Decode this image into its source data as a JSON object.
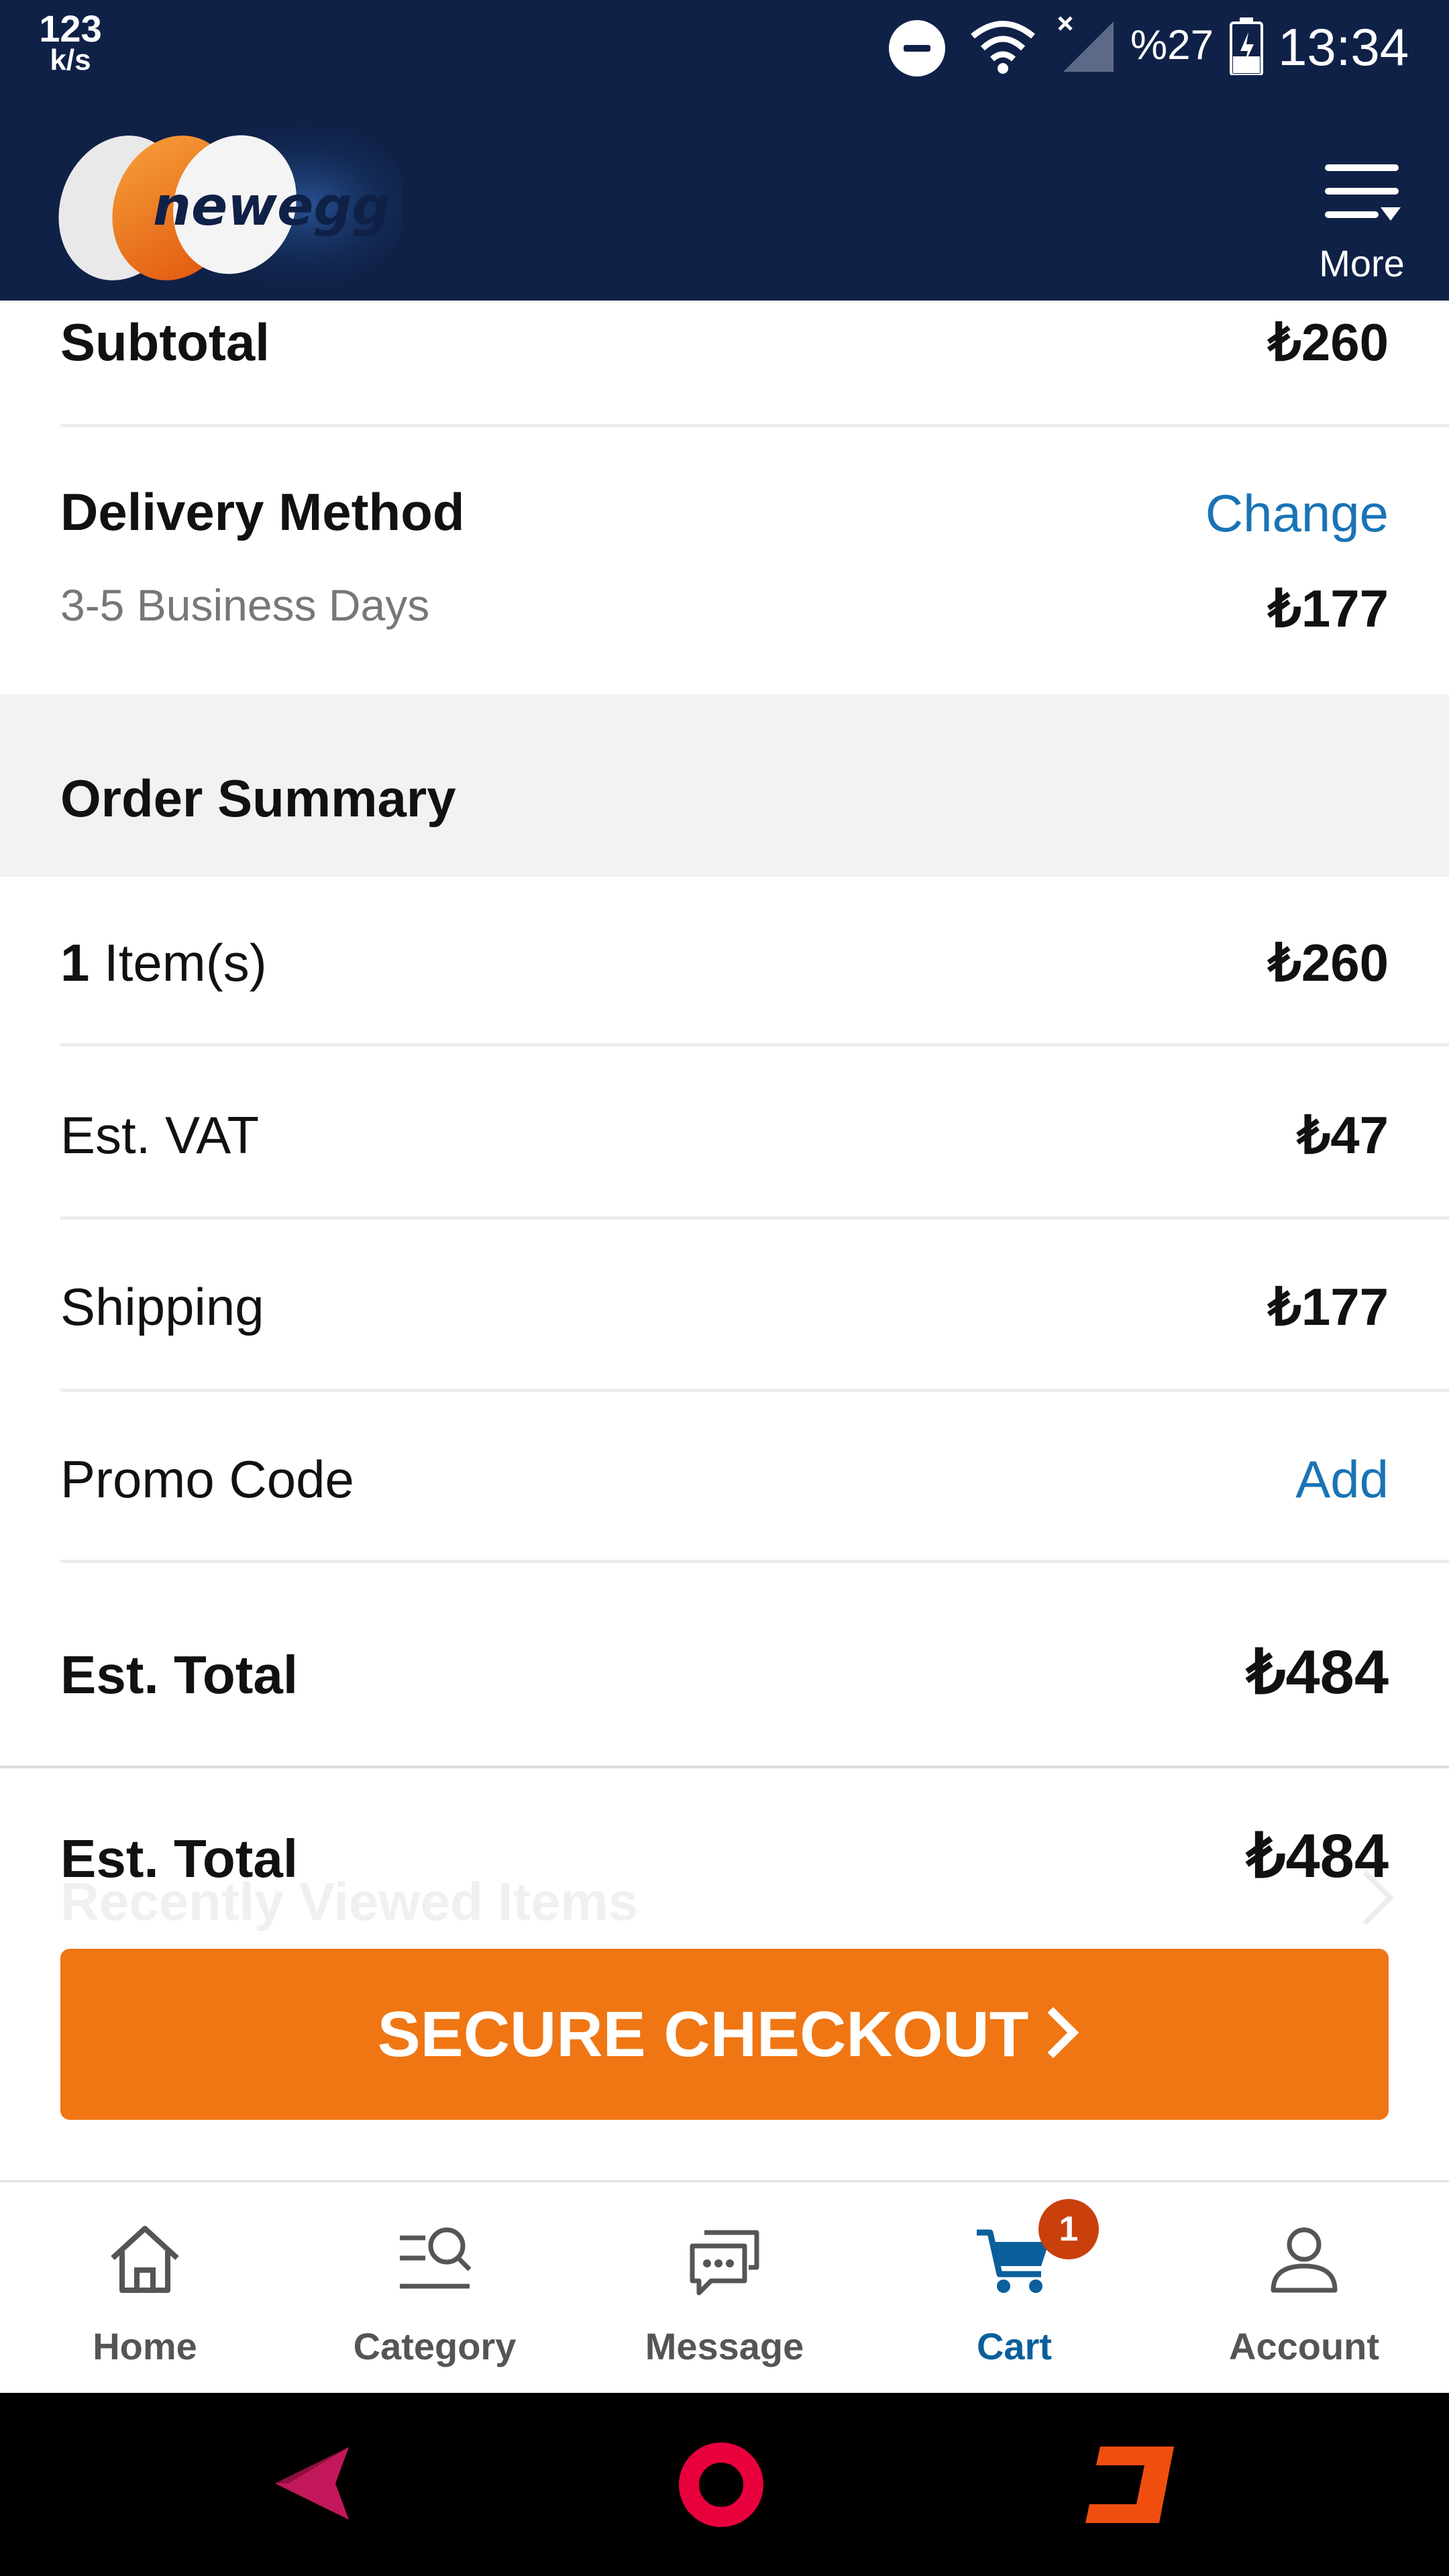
{
  "status_bar": {
    "speed_value": "123",
    "speed_unit": "k/s",
    "battery_percent": "%27",
    "time": "13:34"
  },
  "header": {
    "logo_text": "newegg",
    "more_label": "More",
    "background_color": "#0f2147"
  },
  "subtotal": {
    "label": "Subtotal",
    "value": "₺260"
  },
  "delivery": {
    "title": "Delivery Method",
    "change_label": "Change",
    "option": "3-5 Business Days",
    "price": "₺177"
  },
  "order_summary": {
    "title": "Order Summary",
    "items_count": "1",
    "items_label": " Item(s)",
    "items_value": "₺260",
    "vat_label": "Est. VAT",
    "vat_value": "₺47",
    "shipping_label": "Shipping",
    "shipping_value": "₺177",
    "promo_label": "Promo Code",
    "promo_action": "Add",
    "total_label": "Est. Total",
    "total_value": "₺484"
  },
  "sticky_footer": {
    "total_label": "Est. Total",
    "total_value": "₺484",
    "behind_text": "Recently Viewed Items",
    "checkout_label": "SECURE CHECKOUT",
    "checkout_color": "#ef7613"
  },
  "bottom_nav": {
    "items": [
      {
        "label": "Home",
        "icon": "home-icon",
        "active": false
      },
      {
        "label": "Category",
        "icon": "category-search-icon",
        "active": false
      },
      {
        "label": "Message",
        "icon": "chat-icon",
        "active": false
      },
      {
        "label": "Cart",
        "icon": "cart-icon",
        "active": true,
        "badge": "1"
      },
      {
        "label": "Account",
        "icon": "user-icon",
        "active": false
      }
    ],
    "active_color": "#0b5f9b",
    "badge_color": "#c9400d"
  },
  "link_color": "#1a73b6"
}
